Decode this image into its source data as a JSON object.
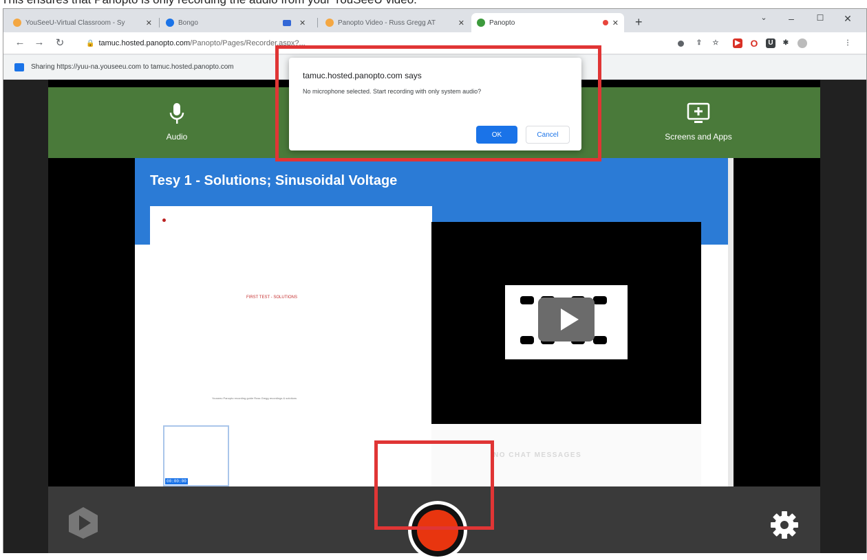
{
  "caption": "This ensures that Panopto is only recording the audio from your YouSeeU video.",
  "tabs": [
    {
      "title": "YouSeeU-Virtual Classroom - Sy",
      "favicon_color": "#f4a742",
      "active": false
    },
    {
      "title": "Bongo",
      "favicon_color": "#1a73e8",
      "active": false
    },
    {
      "title": "",
      "favicon_color": "#3367d6",
      "active": false
    },
    {
      "title": "Panopto Video - Russ Gregg AT",
      "favicon_color": "#f4a742",
      "active": false
    },
    {
      "title": "Panopto",
      "favicon_color": "#3c9a3c",
      "active": true
    }
  ],
  "address": {
    "host": "tamuc.hosted.panopto.com",
    "path": "/Panopto/Pages/Recorder.aspx?..."
  },
  "sharebar": {
    "text": "Sharing https://yuu-na.youseeu.com to tamuc.hosted.panopto.com"
  },
  "sources": {
    "audio_label": "Audio",
    "screens_label": "Screens and Apps"
  },
  "content": {
    "title": "Tesy 1 - Solutions; Sinusoidal Voltage",
    "slide_text": "FIRST TEST - SOLUTIONS",
    "slide_footer": "Youseeu Panopto recording guide   Russ Gregg   recordings & solutions",
    "thumb_time": "00:00:00",
    "chat_empty": "NO CHAT MESSAGES"
  },
  "dialog": {
    "title": "tamuc.hosted.panopto.com says",
    "message": "No microphone selected. Start recording with only system audio?",
    "ok": "OK",
    "cancel": "Cancel"
  },
  "colors": {
    "green_bar": "#4a7a3a",
    "record": "#e8350f",
    "annotation": "#e03535",
    "content_header": "#2b7bd6"
  }
}
